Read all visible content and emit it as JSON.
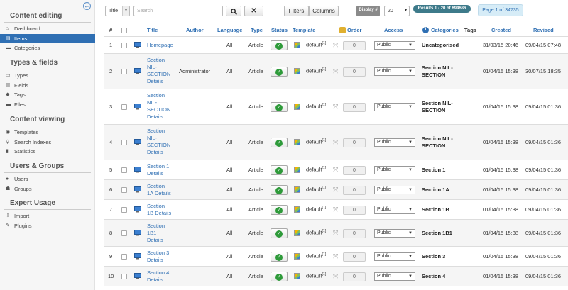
{
  "sidebar": {
    "collapse_icon": "arrow-left-circle-icon",
    "sections": [
      {
        "title": "Content editing",
        "items": [
          {
            "label": "Dashboard",
            "icon": "home-icon",
            "active": false
          },
          {
            "label": "Items",
            "icon": "document-icon",
            "active": true
          },
          {
            "label": "Categories",
            "icon": "folder-icon",
            "active": false
          }
        ]
      },
      {
        "title": "Types & fields",
        "items": [
          {
            "label": "Types",
            "icon": "types-icon",
            "active": false
          },
          {
            "label": "Fields",
            "icon": "fields-icon",
            "active": false
          },
          {
            "label": "Tags",
            "icon": "tag-icon",
            "active": false
          },
          {
            "label": "Files",
            "icon": "file-icon",
            "active": false
          }
        ]
      },
      {
        "title": "Content viewing",
        "items": [
          {
            "label": "Templates",
            "icon": "eye-icon",
            "active": false
          },
          {
            "label": "Search Indexes",
            "icon": "search-index-icon",
            "active": false
          },
          {
            "label": "Statistics",
            "icon": "chart-icon",
            "active": false
          }
        ]
      },
      {
        "title": "Users & Groups",
        "items": [
          {
            "label": "Users",
            "icon": "user-icon",
            "active": false
          },
          {
            "label": "Groups",
            "icon": "group-icon",
            "active": false
          }
        ]
      },
      {
        "title": "Expert Usage",
        "items": [
          {
            "label": "Import",
            "icon": "import-icon",
            "active": false
          },
          {
            "label": "Plugins",
            "icon": "plugin-icon",
            "active": false
          }
        ]
      }
    ]
  },
  "toolbar": {
    "filter_select": "Title",
    "search_placeholder": "Search",
    "filters_label": "Filters",
    "columns_label": "Columns",
    "display_label": "Display #",
    "limit_value": "20",
    "results_label": "Results 1 - 20 of 694686",
    "page_info": "Page 1 of 34735"
  },
  "columns": {
    "num": "#",
    "title": "Title",
    "author": "Author",
    "language": "Language",
    "type": "Type",
    "status": "Status",
    "template": "Template",
    "order": "Order",
    "access": "Access",
    "categories": "Categories",
    "tags": "Tags",
    "created": "Created",
    "revised": "Revised"
  },
  "rows": [
    {
      "num": "1",
      "title": "Homepage",
      "author": "",
      "language": "All",
      "type": "Article",
      "template": "default",
      "order": "0",
      "access": "Public",
      "category": "Uncategorised",
      "created": "31/03/15 20:46",
      "revised": "09/04/15 07:48"
    },
    {
      "num": "2",
      "title": "Section\nNIL-\nSECTION\nDetails",
      "author": "Administrator",
      "language": "All",
      "type": "Article",
      "template": "default",
      "order": "0",
      "access": "Public",
      "category": "Section NIL-\nSECTION",
      "created": "01/04/15 15:38",
      "revised": "30/07/15 18:35"
    },
    {
      "num": "3",
      "title": "Section\nNIL-\nSECTION\nDetails",
      "author": "",
      "language": "All",
      "type": "Article",
      "template": "default",
      "order": "0",
      "access": "Public",
      "category": "Section NIL-\nSECTION",
      "created": "01/04/15 15:38",
      "revised": "09/04/15 01:36"
    },
    {
      "num": "4",
      "title": "Section\nNIL-\nSECTION\nDetails",
      "author": "",
      "language": "All",
      "type": "Article",
      "template": "default",
      "order": "0",
      "access": "Public",
      "category": "Section NIL-\nSECTION",
      "created": "01/04/15 15:38",
      "revised": "09/04/15 01:36"
    },
    {
      "num": "5",
      "title": "Section 1\nDetails",
      "author": "",
      "language": "All",
      "type": "Article",
      "template": "default",
      "order": "0",
      "access": "Public",
      "category": "Section 1",
      "created": "01/04/15 15:38",
      "revised": "09/04/15 01:36"
    },
    {
      "num": "6",
      "title": "Section\n1A Details",
      "author": "",
      "language": "All",
      "type": "Article",
      "template": "default",
      "order": "0",
      "access": "Public",
      "category": "Section 1A",
      "created": "01/04/15 15:38",
      "revised": "09/04/15 01:36"
    },
    {
      "num": "7",
      "title": "Section\n1B Details",
      "author": "",
      "language": "All",
      "type": "Article",
      "template": "default",
      "order": "0",
      "access": "Public",
      "category": "Section 1B",
      "created": "01/04/15 15:38",
      "revised": "09/04/15 01:36"
    },
    {
      "num": "8",
      "title": "Section\n1B1\nDetails",
      "author": "",
      "language": "All",
      "type": "Article",
      "template": "default",
      "order": "0",
      "access": "Public",
      "category": "Section 1B1",
      "created": "01/04/15 15:38",
      "revised": "09/04/15 01:36"
    },
    {
      "num": "9",
      "title": "Section 3\nDetails",
      "author": "",
      "language": "All",
      "type": "Article",
      "template": "default",
      "order": "0",
      "access": "Public",
      "category": "Section 3",
      "created": "01/04/15 15:38",
      "revised": "09/04/15 01:36"
    },
    {
      "num": "10",
      "title": "Section 4\nDetails",
      "author": "",
      "language": "All",
      "type": "Article",
      "template": "default",
      "order": "0",
      "access": "Public",
      "category": "Section 4",
      "created": "01/04/15 15:38",
      "revised": "09/04/15 01:36"
    }
  ],
  "icons": {
    "status": "published-check-icon",
    "template": "template-icon",
    "drag": "drag-handle-icon",
    "order_header": "order-save-icon",
    "categories_info": "info-icon",
    "row_type": "screen-icon"
  },
  "colors": {
    "accent": "#2f6fb3",
    "active_item": "#2f6fb3",
    "published": "#2e9a3a",
    "results_badge": "#3d7a8a"
  }
}
